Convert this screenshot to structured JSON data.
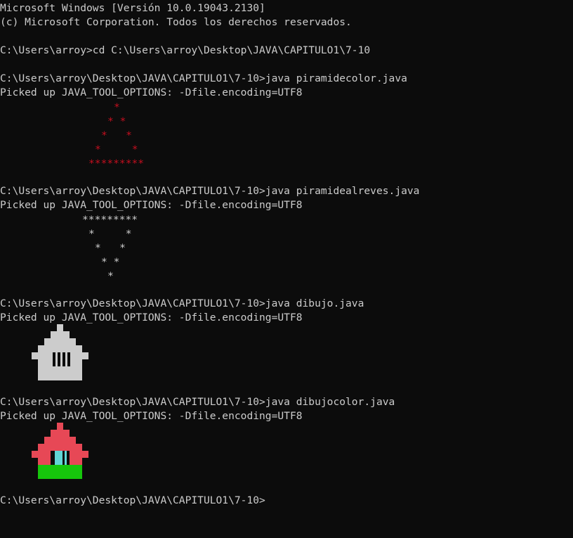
{
  "header": {
    "version": "Microsoft Windows [Versión 10.0.19043.2130]",
    "copyright": "(c) Microsoft Corporation. Todos los derechos reservados."
  },
  "commands": {
    "cd": "C:\\Users\\arroy>cd C:\\Users\\arroy\\Desktop\\JAVA\\CAPITULO1\\7-10",
    "run1": "C:\\Users\\arroy\\Desktop\\JAVA\\CAPITULO1\\7-10>java piramidecolor.java",
    "run2": "C:\\Users\\arroy\\Desktop\\JAVA\\CAPITULO1\\7-10>java piramidealreves.java",
    "run3": "C:\\Users\\arroy\\Desktop\\JAVA\\CAPITULO1\\7-10>java dibujo.java",
    "run4": "C:\\Users\\arroy\\Desktop\\JAVA\\CAPITULO1\\7-10>java dibujocolor.java",
    "prompt": "C:\\Users\\arroy\\Desktop\\JAVA\\CAPITULO1\\7-10>"
  },
  "picked_up": "Picked up JAVA_TOOL_OPTIONS: -Dfile.encoding=UTF8",
  "pyramid_up": {
    "lines": [
      "*",
      "* *",
      "*   *",
      "*     *",
      "*********"
    ],
    "color": "#c50f1f"
  },
  "pyramid_down": {
    "lines": [
      "*********",
      "*     *",
      "*   *",
      "* *",
      "*"
    ]
  },
  "house_gray": {
    "wall_color": "#cccccc",
    "window_color": "#0c0c0c"
  },
  "house_color": {
    "roof_color": "#e74856",
    "door_color": "#61d6d6",
    "grass_color": "#16c60c",
    "frame_color": "#0c0c0c"
  }
}
